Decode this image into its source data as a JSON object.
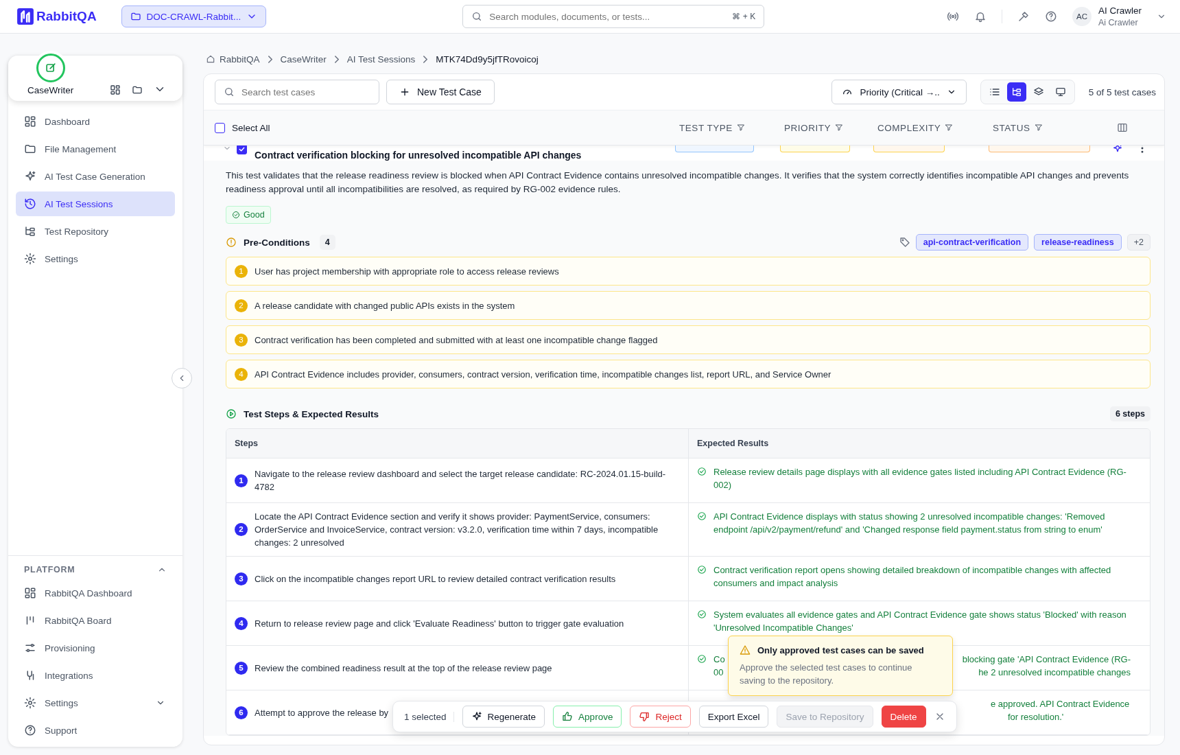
{
  "header": {
    "brand": "RabbitQA",
    "project": "DOC-CRAWL-Rabbit...",
    "search": {
      "placeholder": "Search modules, documents, or tests...",
      "shortcut": "⌘ + K"
    },
    "user": {
      "initials": "AC",
      "name": "AI Crawler",
      "role": "Ai Crawler"
    }
  },
  "sidebar": {
    "app": "CaseWriter",
    "items": [
      {
        "label": "Dashboard",
        "selected": false
      },
      {
        "label": "File Management",
        "selected": false
      },
      {
        "label": "AI Test Case Generation",
        "selected": false
      },
      {
        "label": "AI Test Sessions",
        "selected": true
      },
      {
        "label": "Test Repository",
        "selected": false
      },
      {
        "label": "Settings",
        "selected": false
      }
    ],
    "platform": {
      "title": "PLATFORM",
      "expanded": true,
      "items": [
        {
          "label": "RabbitQA Dashboard",
          "expandable": false
        },
        {
          "label": "RabbitQA Board",
          "expandable": false
        },
        {
          "label": "Provisioning",
          "expandable": false
        },
        {
          "label": "Integrations",
          "expandable": false
        },
        {
          "label": "Settings",
          "expandable": true
        },
        {
          "label": "Support",
          "expandable": false
        }
      ]
    }
  },
  "breadcrumb": [
    "RabbitQA",
    "CaseWriter",
    "AI Test Sessions",
    "MTK74Dd9y5jfTRovoicoj"
  ],
  "toolbar": {
    "search_placeholder": "Search test cases",
    "new_button": "New Test Case",
    "sort": "Priority (Critical →..",
    "views": [
      {
        "selected": false
      },
      {
        "selected": true
      },
      {
        "selected": false
      },
      {
        "selected": false
      }
    ],
    "count": "5 of 5 test cases"
  },
  "table_header": {
    "select_all": "Select All",
    "checked": false,
    "columns": [
      "TEST TYPE",
      "PRIORITY",
      "COMPLEXITY",
      "STATUS"
    ]
  },
  "test_case": {
    "title": "Contract verification blocking for unresolved incompatible API changes",
    "checked": true,
    "description": "This test validates that the release readiness review is blocked when API Contract Evidence contains unresolved incompatible changes. It verifies that the system correctly identifies incompatible API changes and prevents readiness approval until all incompatibilities are resolved, as required by RG-002 evidence rules.",
    "quality": "Good",
    "preconditions": {
      "title": "Pre-Conditions",
      "count": "4",
      "tags": [
        "api-contract-verification",
        "release-readiness"
      ],
      "more": "+2",
      "items": [
        {
          "number": "1",
          "text": "User has project membership with appropriate role to access release reviews"
        },
        {
          "number": "2",
          "text": "A release candidate with changed public APIs exists in the system"
        },
        {
          "number": "3",
          "text": "Contract verification has been completed and submitted with at least one incompatible change flagged"
        },
        {
          "number": "4",
          "text": "API Contract Evidence includes provider, consumers, contract version, verification time, incompatible changes list, report URL, and Service Owner"
        }
      ]
    },
    "steps": {
      "title": "Test Steps & Expected Results",
      "count": "6 steps",
      "columns": [
        "Steps",
        "Expected Results"
      ],
      "rows": [
        {
          "kind": "full",
          "number": "1",
          "step": "Navigate to the release review dashboard and select the target release candidate: RC-2024.01.15-build-4782",
          "expected": "Release review details page displays with all evidence gates listed including API Contract Evidence (RG-002)"
        },
        {
          "kind": "full",
          "number": "2",
          "step": "Locate the API Contract Evidence section and verify it shows provider: PaymentService, consumers: OrderService and InvoiceService, contract version: v3.2.0, verification time within 7 days, incompatible changes: 2 unresolved",
          "expected": "API Contract Evidence displays with status showing 2 unresolved incompatible changes: 'Removed endpoint /api/v2/payment/refund' and 'Changed response field payment.status from string to enum'"
        },
        {
          "kind": "full",
          "number": "3",
          "step": "Click on the incompatible changes report URL to review detailed contract verification results",
          "expected": "Contract verification report opens showing detailed breakdown of incompatible changes with affected consumers and impact analysis"
        },
        {
          "kind": "full",
          "number": "4",
          "step": "Return to release review page and click 'Evaluate Readiness' button to trigger gate evaluation",
          "expected": "System evaluates all evidence gates and API Contract Evidence gate shows status 'Blocked' with reason 'Unresolved Incompatible Changes'"
        },
        {
          "kind": "split",
          "number": "5",
          "step": "Review the combined readiness result at the top of the release review page",
          "expected_lines": [
            [
              "Co",
              "blocking gate 'API Contract Evidence (RG-"
            ],
            [
              "00",
              "he 2 unresolved incompatible changes"
            ]
          ]
        },
        {
          "kind": "covered",
          "number": "6",
          "step": "Attempt to approve the release by",
          "expected_lines": [
            [
              "e approved. API Contract Evidence"
            ],
            [
              "for resolution.'"
            ]
          ]
        }
      ]
    }
  },
  "tooltip": {
    "title": "Only approved test cases can be saved",
    "text": "Approve the selected test cases to continue saving to the repository."
  },
  "action_bar": {
    "selected": "1 selected",
    "regenerate": "Regenerate",
    "approve": "Approve",
    "reject": "Reject",
    "export": "Export Excel",
    "save": "Save to Repository",
    "save_disabled": true,
    "delete": "Delete"
  }
}
